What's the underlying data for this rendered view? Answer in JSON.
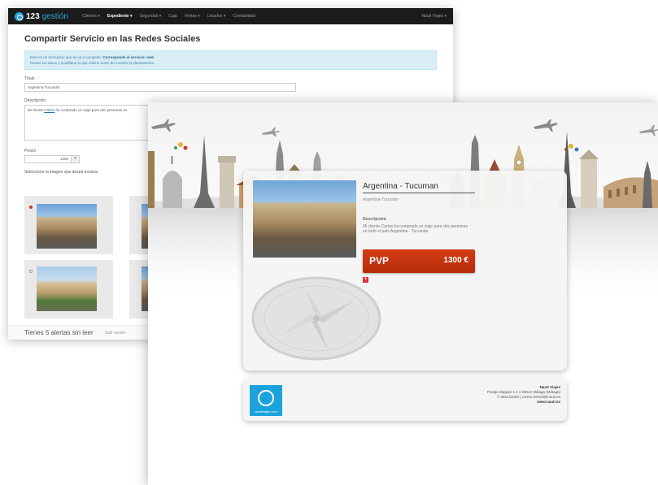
{
  "back_window": {
    "brand": {
      "prefix": "123",
      "suffix": "gestión"
    },
    "nav": [
      "Clientes ▾",
      "Expediente ▾",
      "Seguridad ▾",
      "Caja",
      "Ventas ▾",
      "Listados ▾",
      "Contabilidad"
    ],
    "nav_active_index": 1,
    "user_menu": "Nauti Viajes ▾",
    "page_title": "Compartir Servicio en las Redes Sociales",
    "alert": {
      "line1_text": "Este es un formulario que se va a compartir.",
      "line1_bold": "Corresponde al servicio: web",
      "line2": "Revise los datos y modifique lo que estime antes de mostrar la plantamiento."
    },
    "title_label": "Título",
    "title_value": "Argentina-Tucumán",
    "description_label": "Descripción",
    "description_prefix": "Mi cliente ",
    "description_link": "Carlos",
    "description_suffix": " ha comprado un viaje para dos personas en",
    "price_label": "Precio",
    "price_value": "1300",
    "price_unit": "€",
    "image_select_label": "Seleccione la imagen que desea mostrar",
    "footer_alerts": "Tienes 5 alertas sin leer",
    "footer_link": "Salir sesión"
  },
  "front_window": {
    "card": {
      "title": "Argentina - Tucuman",
      "subtitle": "Argentina-Tucumán",
      "description_label": "Descripción",
      "description": "Mi cliente Carlos ha comprado un viaje para dos personas en todo el país Argentina - Tucumán.",
      "pvp_label": "PVP",
      "price": "1300 €"
    },
    "footer": {
      "logo_text": "nautiviajes.com",
      "company": "Nauti Viajes",
      "address": "Pasaje Zagaya 4 2 4 29010 Málaga (Málaga)",
      "contact": "T: 955123450 | correo.mimail@nauti.es",
      "website": "www.nauti.es"
    }
  },
  "colors": {
    "nav_bg": "#1b1b1b",
    "brand_accent": "#2ea3de",
    "alert_bg": "#d9edf7",
    "pvp_red": "#c6340f",
    "logo_blue": "#1aa3dc"
  }
}
